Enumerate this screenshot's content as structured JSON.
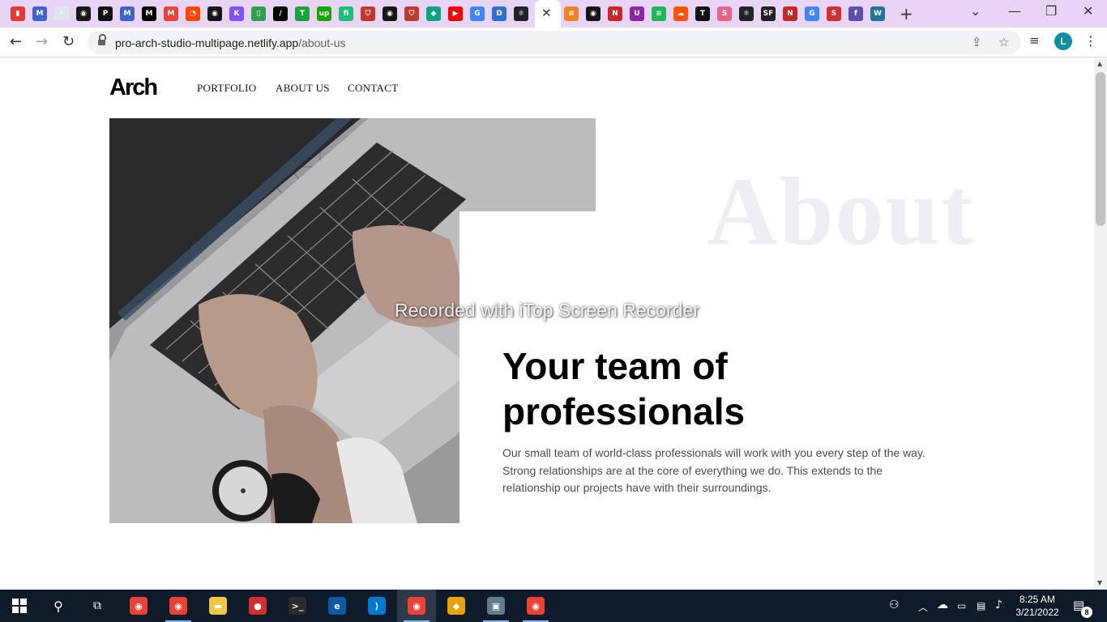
{
  "browser": {
    "tabs": [
      {
        "icon": "bookmark-icon",
        "color": "#e53935",
        "label": "▮"
      },
      {
        "icon": "mh-logo-icon",
        "color": "#3f63c9",
        "label": "M"
      },
      {
        "icon": "blank-page-icon",
        "color": "#dfe6ee",
        "label": "·"
      },
      {
        "icon": "github-icon",
        "color": "#181717",
        "label": "◉"
      },
      {
        "icon": "p-logo-icon",
        "color": "#111111",
        "label": "P"
      },
      {
        "icon": "mh-logo-icon",
        "color": "#3f63c9",
        "label": "M"
      },
      {
        "icon": "medium-icon",
        "color": "#000000",
        "label": "M"
      },
      {
        "icon": "gmail-icon",
        "color": "#ea4335",
        "label": "M"
      },
      {
        "icon": "reddit-icon",
        "color": "#ff4500",
        "label": "◔"
      },
      {
        "icon": "github-icon",
        "color": "#181717",
        "label": "◉"
      },
      {
        "icon": "kotlin-icon",
        "color": "#7f52ff",
        "label": "K"
      },
      {
        "icon": "phone-icon",
        "color": "#2e9e4f",
        "label": "▯"
      },
      {
        "icon": "slash-icon",
        "color": "#000000",
        "label": "/"
      },
      {
        "icon": "trello-icon",
        "color": "#1aa33a",
        "label": "T"
      },
      {
        "icon": "upwork-icon",
        "color": "#14a800",
        "label": "up"
      },
      {
        "icon": "fiverr-icon",
        "color": "#1dbf73",
        "label": "fi"
      },
      {
        "icon": "shield-icon",
        "color": "#c0392b",
        "label": "⛉"
      },
      {
        "icon": "github-icon",
        "color": "#181717",
        "label": "◉"
      },
      {
        "icon": "shield-icon",
        "color": "#c0392b",
        "label": "⛉"
      },
      {
        "icon": "diamond-icon",
        "color": "#10a37f",
        "label": "◆"
      },
      {
        "icon": "youtube-icon",
        "color": "#ff0000",
        "label": "▶"
      },
      {
        "icon": "google-icon",
        "color": "#4285f4",
        "label": "G"
      },
      {
        "icon": "dnd-icon",
        "color": "#2f6fd1",
        "label": "D"
      },
      {
        "icon": "react-icon",
        "color": "#20232a",
        "label": "⚛"
      }
    ],
    "tabs_after": [
      {
        "icon": "stackoverflow-icon",
        "color": "#f48024",
        "label": "≡"
      },
      {
        "icon": "github-icon",
        "color": "#181717",
        "label": "◉"
      },
      {
        "icon": "n-logo-icon",
        "color": "#c62828",
        "label": "N"
      },
      {
        "icon": "u-logo-icon",
        "color": "#8e24aa",
        "label": "U"
      },
      {
        "icon": "spotify-icon",
        "color": "#1db954",
        "label": "≋"
      },
      {
        "icon": "soundcloud-icon",
        "color": "#ff5500",
        "label": "☁"
      },
      {
        "icon": "t-logo-icon",
        "color": "#111111",
        "label": "T"
      },
      {
        "icon": "s-logo-icon",
        "color": "#e96384",
        "label": "S"
      },
      {
        "icon": "react-icon",
        "color": "#20232a",
        "label": "⚛"
      },
      {
        "icon": "sf-logo-icon",
        "color": "#222222",
        "label": "SF"
      },
      {
        "icon": "n-logo-icon",
        "color": "#c62828",
        "label": "N"
      },
      {
        "icon": "google-icon",
        "color": "#4285f4",
        "label": "G"
      },
      {
        "icon": "s-logo-icon",
        "color": "#d32f2f",
        "label": "S"
      },
      {
        "icon": "figma-icon",
        "color": "#5b4fb0",
        "label": "f"
      },
      {
        "icon": "wordpress-icon",
        "color": "#21759b",
        "label": "W"
      }
    ],
    "url_host": "pro-arch-studio-multipage.netlify.app",
    "url_path": "/about-us",
    "profile_initial": "L"
  },
  "site": {
    "logo": "Arch",
    "nav": {
      "portfolio": "PORTFOLIO",
      "about": "ABOUT US",
      "contact": "CONTACT"
    },
    "about_word": "About",
    "watermark": "Recorded with iTop Screen Recorder",
    "headline_line1": "Your team of",
    "headline_line2": "professionals",
    "body": "Our small team of world-class professionals will work with you every step of the way. Strong relationships are at the core of everything we do. This extends to the relationship our projects have with their surroundings."
  },
  "taskbar": {
    "time": "8:25 AM",
    "date": "3/21/2022",
    "notification_count": "8",
    "apps": [
      {
        "name": "chrome-icon",
        "color": "#ea4335",
        "label": "◉"
      },
      {
        "name": "chrome-profile-r-icon",
        "color": "#ea4335",
        "label": "◉"
      },
      {
        "name": "file-explorer-icon",
        "color": "#f4c542",
        "label": "▬"
      },
      {
        "name": "screen-recorder-icon",
        "color": "#d32f2f",
        "label": "●"
      },
      {
        "name": "terminal-icon",
        "color": "#2b2b2b",
        "label": ">_"
      },
      {
        "name": "edge-icon",
        "color": "#0c59a4",
        "label": "e"
      },
      {
        "name": "vscode-icon",
        "color": "#007acc",
        "label": "⟩"
      },
      {
        "name": "chrome-profile-l-icon",
        "color": "#ea4335",
        "label": "◉"
      },
      {
        "name": "git-tool-icon",
        "color": "#e5a50a",
        "label": "◆"
      },
      {
        "name": "remote-desktop-icon",
        "color": "#607d8b",
        "label": "▣"
      },
      {
        "name": "chrome-profile-r2-icon",
        "color": "#ea4335",
        "label": "◉"
      }
    ]
  }
}
